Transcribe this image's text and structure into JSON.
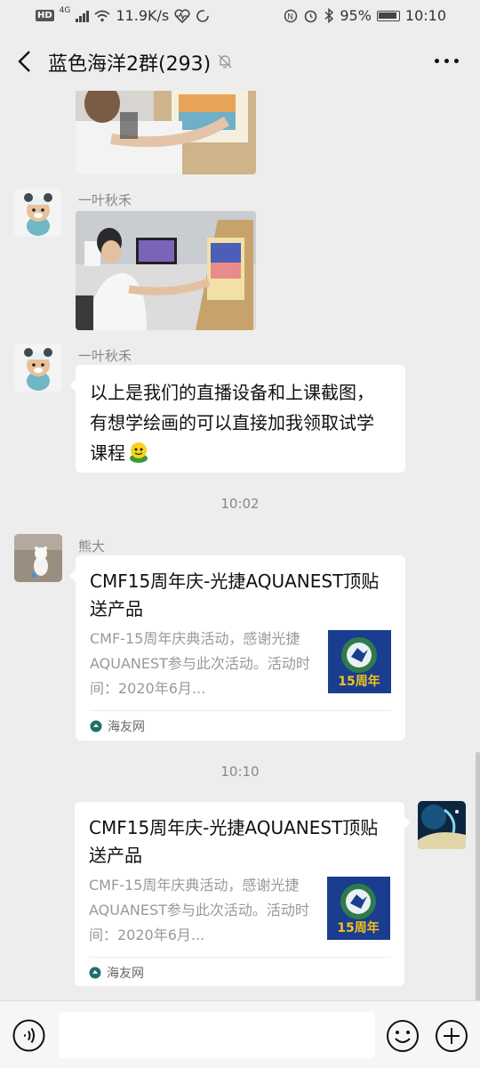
{
  "status_bar": {
    "hd": "HD",
    "network": "4G",
    "speed": "11.9K/s",
    "battery": "95%",
    "time": "10:10"
  },
  "header": {
    "title": "蓝色海洋2群(293)"
  },
  "messages": [
    {
      "type": "image",
      "sender": "一叶秋禾",
      "icon": "painting-photo"
    },
    {
      "type": "image",
      "sender": "一叶秋禾",
      "icon": "painting-photo"
    },
    {
      "type": "text",
      "sender": "一叶秋禾",
      "text": "以上是我们的直播设备和上课截图，有想学绘画的可以直接加我领取试学课程"
    },
    {
      "type": "time",
      "text": "10:02"
    },
    {
      "type": "link_card",
      "sender": "熊大",
      "title": "CMF15周年庆-光捷AQUANEST顶贴送产品",
      "desc": "CMF-15周年庆典活动，感谢光捷AQUANEST参与此次活动。活动时间：2020年6月...",
      "thumb_text": "15周年",
      "source": "海友网"
    },
    {
      "type": "time",
      "text": "10:10"
    },
    {
      "type": "link_card",
      "sender": "me",
      "title": "CMF15周年庆-光捷AQUANEST顶贴送产品",
      "desc": "CMF-15周年庆典活动，感谢光捷AQUANEST参与此次活动。活动时间：2020年6月...",
      "thumb_text": "15周年",
      "source": "海友网"
    }
  ],
  "input_bar": {
    "placeholder": "",
    "icons": [
      "voice-icon",
      "emoji-icon",
      "plus-icon"
    ]
  },
  "colors": {
    "background": "#ededed",
    "bubble": "#ffffff",
    "brand_blue": "#1a3d8f",
    "thumb_yellow": "#f2c318"
  }
}
